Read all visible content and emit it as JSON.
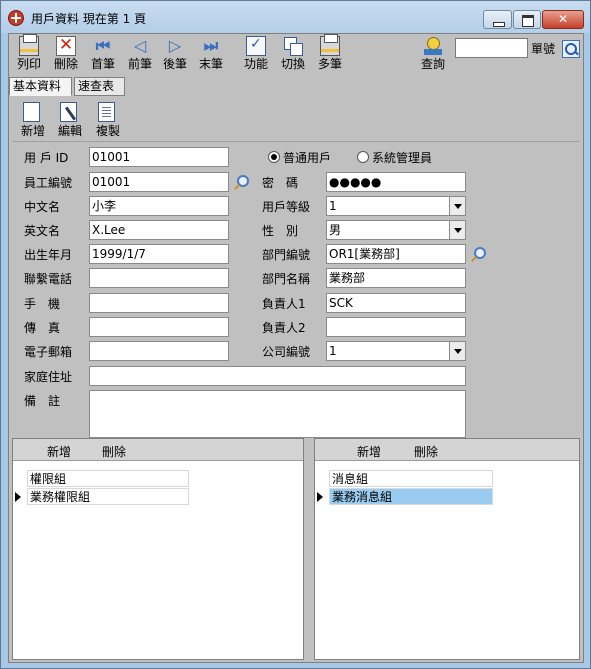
{
  "window": {
    "title": "用戶資料  現在第 1 頁"
  },
  "toolbar": {
    "print": "列印",
    "delete": "刪除",
    "first": "首筆",
    "prev": "前筆",
    "next": "後筆",
    "last": "末筆",
    "function": "功能",
    "switch": "切換",
    "multi": "多筆",
    "query": "查詢"
  },
  "search": {
    "value": "",
    "label": "單號"
  },
  "tabs": [
    {
      "label": "基本資料",
      "active": true
    },
    {
      "label": "速查表",
      "active": false
    }
  ],
  "actions": {
    "new": "新增",
    "edit": "編輯",
    "copy": "複製"
  },
  "form": {
    "user_id": {
      "label": "用 戶 ID",
      "value": "01001"
    },
    "user_type": {
      "options": [
        "普通用戶",
        "系統管理員"
      ],
      "selected": "普通用戶"
    },
    "employee_no": {
      "label": "員工編號",
      "value": "01001"
    },
    "password": {
      "label": "密　碼",
      "value": "●●●●●"
    },
    "chinese_name": {
      "label": "中文名",
      "value": "小李"
    },
    "user_level": {
      "label": "用戶等級",
      "value": "1"
    },
    "english_name": {
      "label": "英文名",
      "value": "X.Lee"
    },
    "gender": {
      "label": "性　別",
      "value": "男"
    },
    "birth_date": {
      "label": "出生年月",
      "value": "1999/1/7"
    },
    "dept_no": {
      "label": "部門編號",
      "value": "OR1[業務部]"
    },
    "phone": {
      "label": "聯繫電話",
      "value": ""
    },
    "dept_name": {
      "label": "部門名稱",
      "value": "業務部"
    },
    "mobile": {
      "label": "手　機",
      "value": ""
    },
    "manager1": {
      "label": "負責人1",
      "value": "SCK"
    },
    "fax": {
      "label": "傳　真",
      "value": ""
    },
    "manager2": {
      "label": "負責人2",
      "value": ""
    },
    "email": {
      "label": "電子郵箱",
      "value": ""
    },
    "company_no": {
      "label": "公司編號",
      "value": "1"
    },
    "address": {
      "label": "家庭住址",
      "value": ""
    },
    "remark": {
      "label": "備　註",
      "value": ""
    }
  },
  "left_pane": {
    "add": "新增",
    "delete": "刪除",
    "items": [
      "權限組",
      "業務權限組"
    ],
    "current": 1
  },
  "right_pane": {
    "add": "新增",
    "delete": "刪除",
    "items": [
      "消息組",
      "業務消息組"
    ],
    "current": 1,
    "selected": 1
  }
}
